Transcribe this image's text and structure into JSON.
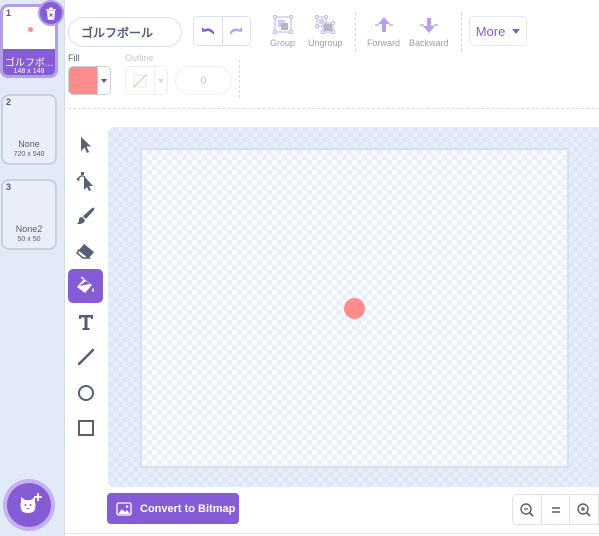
{
  "costumes": [
    {
      "number": "1",
      "name": "ゴルフボ...",
      "size": "148 x 148",
      "selected": true
    },
    {
      "number": "2",
      "name": "None",
      "size": "720 x 540",
      "selected": false
    },
    {
      "number": "3",
      "name": "None2",
      "size": "50 x 50",
      "selected": false
    }
  ],
  "icons": {
    "delete": "trash-icon",
    "add_costume": "cat-add-icon"
  },
  "toolbar": {
    "costume_name": "ゴルフボール",
    "group_label": "Group",
    "ungroup_label": "Ungroup",
    "forward_label": "Forward",
    "backward_label": "Backward",
    "more_label": "More"
  },
  "properties": {
    "fill_label": "Fill",
    "outline_label": "Outline",
    "outline_width": "0",
    "fill_color": "#ff8c8c"
  },
  "tools": [
    {
      "name": "select",
      "active": false
    },
    {
      "name": "reshape",
      "active": false
    },
    {
      "name": "brush",
      "active": false
    },
    {
      "name": "eraser",
      "active": false
    },
    {
      "name": "fill",
      "active": true
    },
    {
      "name": "text",
      "active": false
    },
    {
      "name": "line",
      "active": false
    },
    {
      "name": "circle",
      "active": false
    },
    {
      "name": "rectangle",
      "active": false
    }
  ],
  "bottom": {
    "convert_label": "Convert to Bitmap"
  },
  "colors": {
    "accent": "#855cd6",
    "ball": "#ff8c8c"
  }
}
